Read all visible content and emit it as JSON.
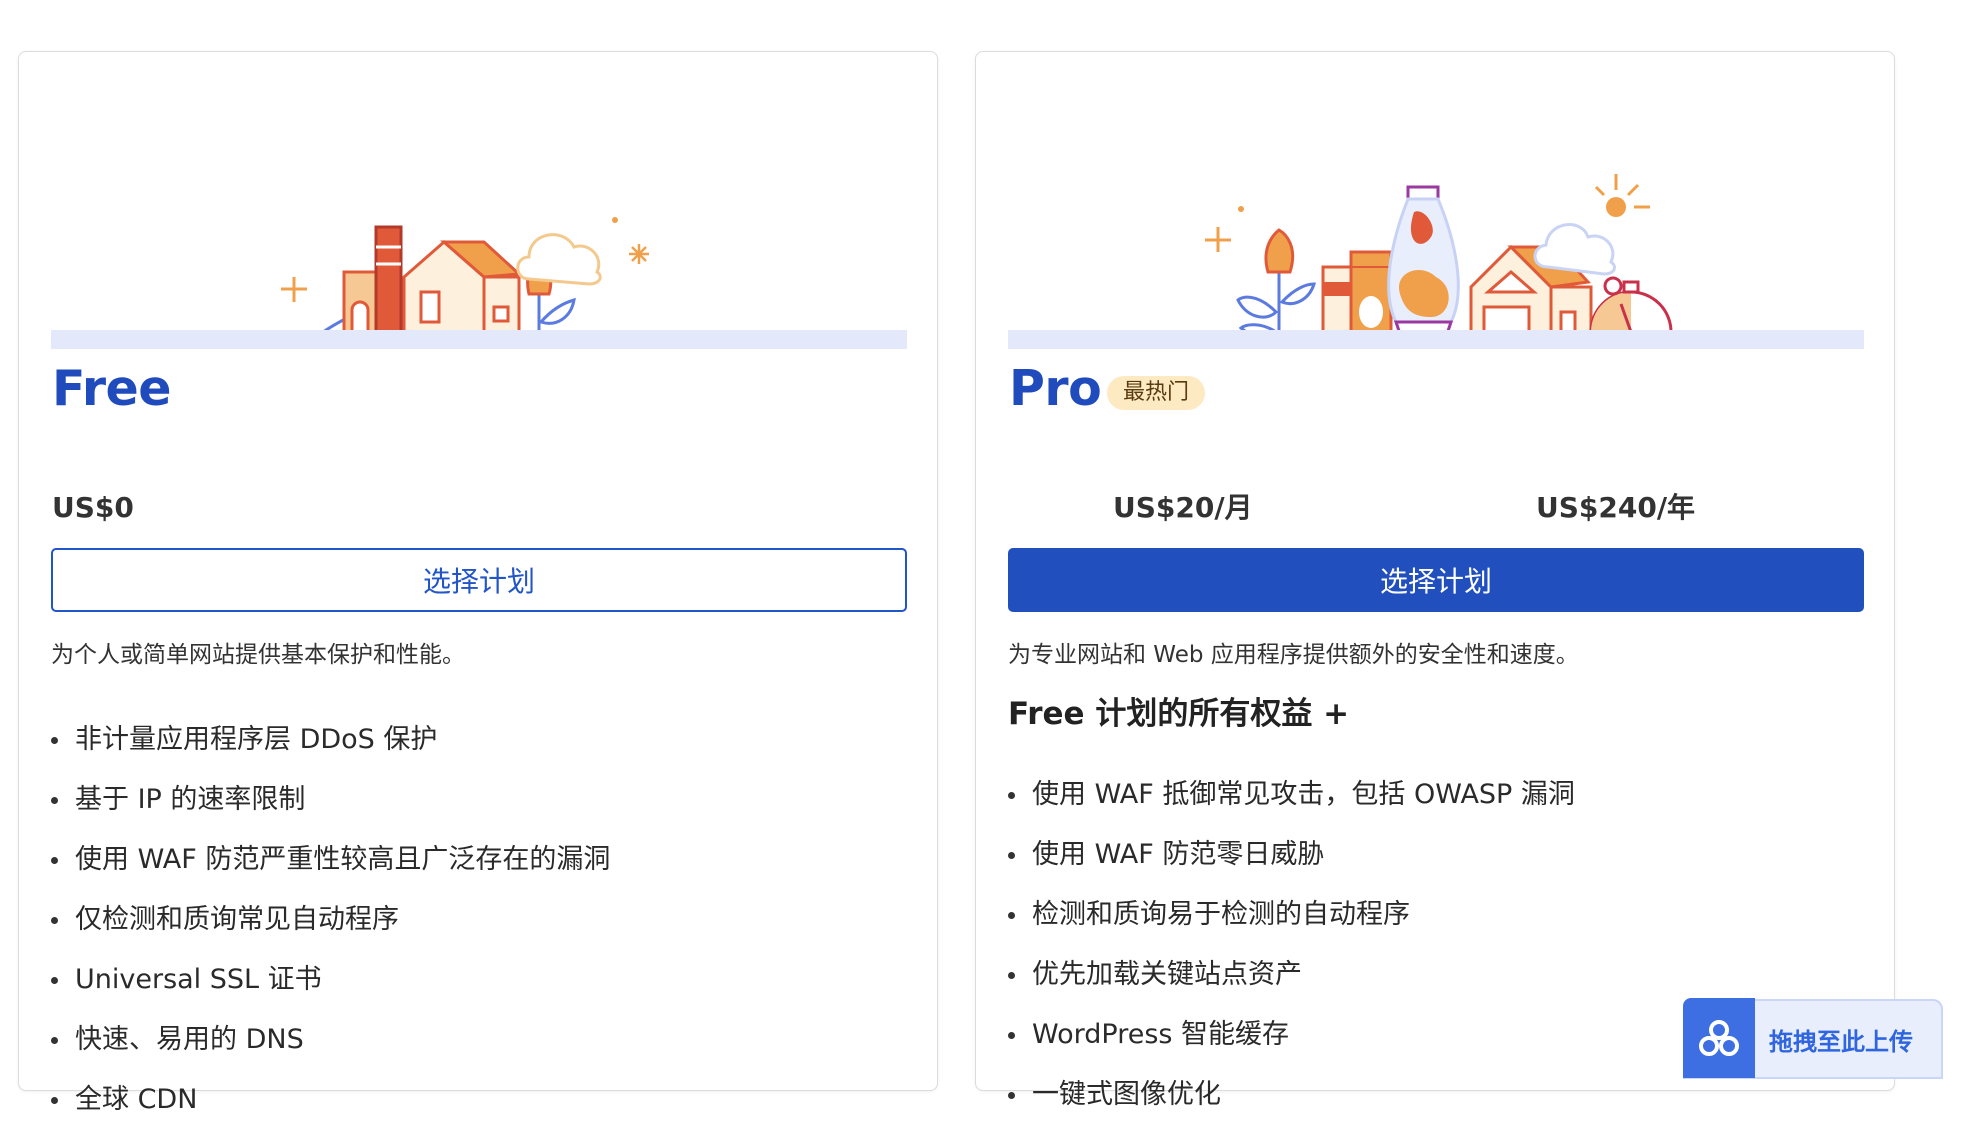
{
  "plans": {
    "free": {
      "name": "Free",
      "price": "US$0",
      "button_label": "选择计划",
      "description": "为个人或简单网站提供基本保护和性能。",
      "features": [
        "非计量应用程序层 DDoS 保护",
        "基于 IP 的速率限制",
        "使用 WAF 防范严重性较高且广泛存在的漏洞",
        "仅检测和质询常见自动程序",
        "Universal SSL 证书",
        "快速、易用的 DNS",
        "全球 CDN"
      ]
    },
    "pro": {
      "name": "Pro",
      "badge": "最热门",
      "price_monthly": "US$20/月",
      "price_yearly": "US$240/年",
      "button_label": "选择计划",
      "description": "为专业网站和 Web 应用程序提供额外的安全性和速度。",
      "inherit_heading": "Free 计划的所有权益 +",
      "features": [
        "使用 WAF 抵御常见攻击，包括 OWASP 漏洞",
        "使用 WAF 防范零日威胁",
        "检测和质询易于检测的自动程序",
        "优先加载关键站点资产",
        "WordPress 智能缓存",
        "一键式图像优化"
      ]
    }
  },
  "upload_widget": {
    "label": "拖拽至此上传",
    "icon": "cloud-share-icon"
  },
  "colors": {
    "brand_blue": "#2150be",
    "plan_title": "#1f4bbd",
    "badge_bg": "#fdeac3",
    "illustration_orange": "#f0a04b",
    "illustration_red": "#e05a3a",
    "illustration_blue": "#5b7be0"
  }
}
